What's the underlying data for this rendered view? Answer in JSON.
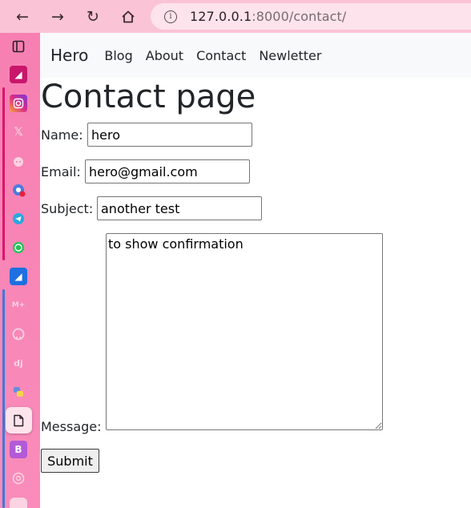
{
  "browser": {
    "url_host": "127.0.0.1",
    "url_rest": ":8000/contact/"
  },
  "site": {
    "brand": "Hero",
    "nav": [
      "Blog",
      "About",
      "Contact",
      "Newletter"
    ]
  },
  "page": {
    "title": "Contact page"
  },
  "form": {
    "name_label": "Name:",
    "name_value": "hero",
    "email_label": "Email:",
    "email_value": "hero@gmail.com",
    "subject_label": "Subject:",
    "subject_value": "another test",
    "message_label": "Message:",
    "message_value": "to show confirmation",
    "submit_label": "Submit"
  },
  "sidebar_icons": [
    "panel-icon",
    "app-icon",
    "instagram-icon",
    "x-icon",
    "reddit-icon",
    "chrome-icon",
    "telegram-icon",
    "whatsapp-icon",
    "app-icon",
    "markdown-icon",
    "github-icon",
    "django-icon",
    "python-icon",
    "document-icon",
    "bootstrap-icon",
    "chatgpt-icon"
  ]
}
